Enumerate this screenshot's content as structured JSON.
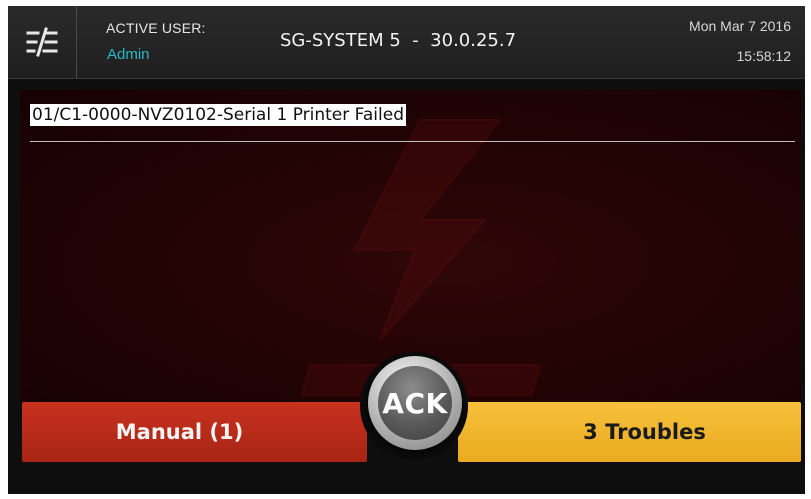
{
  "header": {
    "menu_icon": "filter-list-icon",
    "active_user_label": "ACTIVE USER:",
    "active_user_name": "Admin",
    "system_title": "SG-SYSTEM 5  -  30.0.25.7",
    "date": "Mon Mar 7 2016",
    "time": "15:58:12"
  },
  "event_panel": {
    "events": [
      {
        "text": "01/C1-0000-NVZ0102-Serial 1 Printer Failed"
      }
    ],
    "watermark_icon": "brand-logo-watermark-icon"
  },
  "buttons": {
    "manual_label": "Manual (1)",
    "ack_label": "ACK",
    "troubles_label": "3 Troubles"
  },
  "colors": {
    "header_bg": "#242424",
    "user_name": "#25b9c9",
    "panel_bg": "#200304",
    "manual_btn": "#b82a19",
    "troubles_btn": "#f2b62f",
    "ack_btn": "#5a5a5a"
  }
}
